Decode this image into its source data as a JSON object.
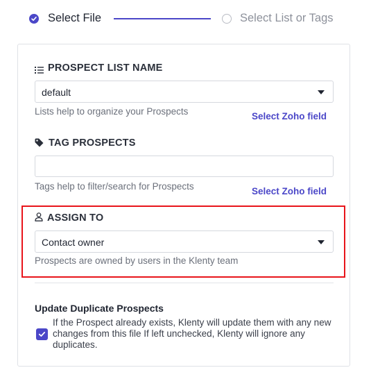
{
  "stepper": {
    "step1_label": "Select File",
    "step2_label": "Select List or Tags",
    "active_color": "#4b47c8"
  },
  "prospect_list": {
    "title": "PROSPECT LIST NAME",
    "icon": "list-icon",
    "value": "default",
    "help": "Lists help to organize your Prospects",
    "link": "Select Zoho field"
  },
  "tag_prospects": {
    "title": "TAG PROSPECTS",
    "icon": "tag-icon",
    "value": "",
    "help": "Tags help to filter/search for Prospects",
    "link": "Select Zoho field"
  },
  "assign_to": {
    "title": "ASSIGN TO",
    "icon": "user-icon",
    "value": "Contact owner",
    "help": "Prospects are owned by users in the Klenty team",
    "highlight_color": "#e8141a"
  },
  "duplicates": {
    "title": "Update Duplicate Prospects",
    "checked": true,
    "text": "If the Prospect already exists, Klenty will update them with any new changes from this file If left unchecked, Klenty will ignore any duplicates."
  }
}
